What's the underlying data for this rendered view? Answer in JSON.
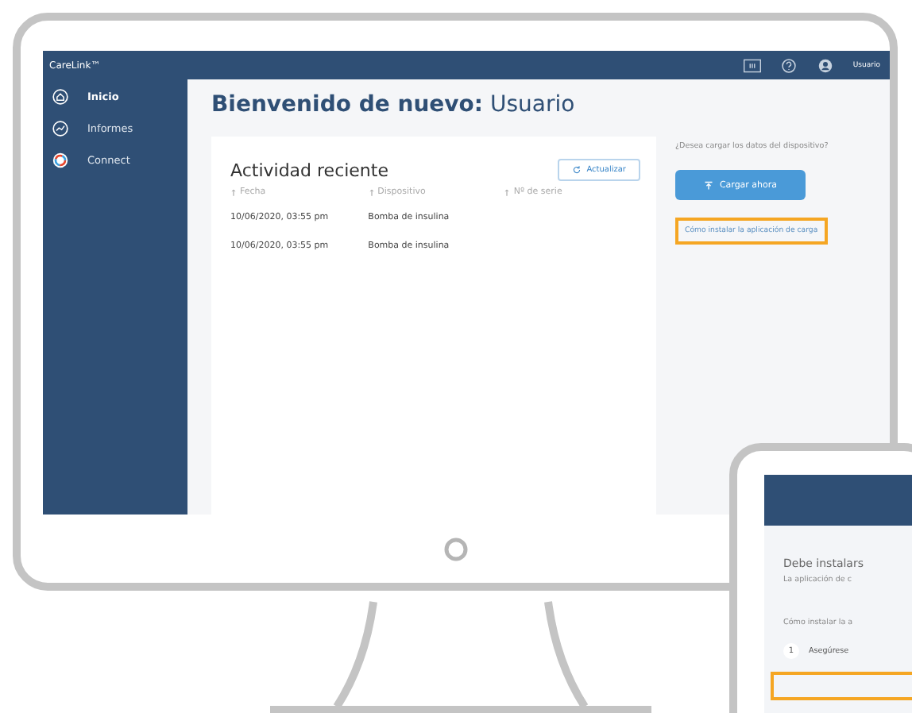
{
  "topbar": {
    "brand": "CareLink™",
    "user": "Usuario"
  },
  "sidebar": {
    "items": [
      {
        "label": "Inicio",
        "kind": "home",
        "selected": true
      },
      {
        "label": "Informes",
        "kind": "chart",
        "selected": false
      },
      {
        "label": "Connect",
        "kind": "connect",
        "selected": false
      }
    ]
  },
  "heading": {
    "bold": "Bienvenido de nuevo:",
    "name": "Usuario"
  },
  "activity": {
    "title": "Actividad reciente",
    "refresh_button": "Actualizar",
    "columns": [
      "Fecha",
      "Dispositivo",
      "Nº de serie"
    ],
    "rows": [
      [
        "10/06/2020, 03:55 pm",
        "Bomba de insulina",
        ""
      ],
      [
        "10/06/2020, 03:55 pm",
        "Bomba de insulina",
        ""
      ]
    ]
  },
  "upload": {
    "question": "¿Desea cargar los datos del dispositivo?",
    "button": "Cargar ahora",
    "link": "Cómo instalar la aplicación de carga",
    "highlighted": true
  },
  "tablet": {
    "title": "Debe instalars",
    "subtitle": "La aplicación de c",
    "how": "Cómo instalar la a",
    "step_number": "1",
    "step": "Asegúrese",
    "highlighted": true
  }
}
